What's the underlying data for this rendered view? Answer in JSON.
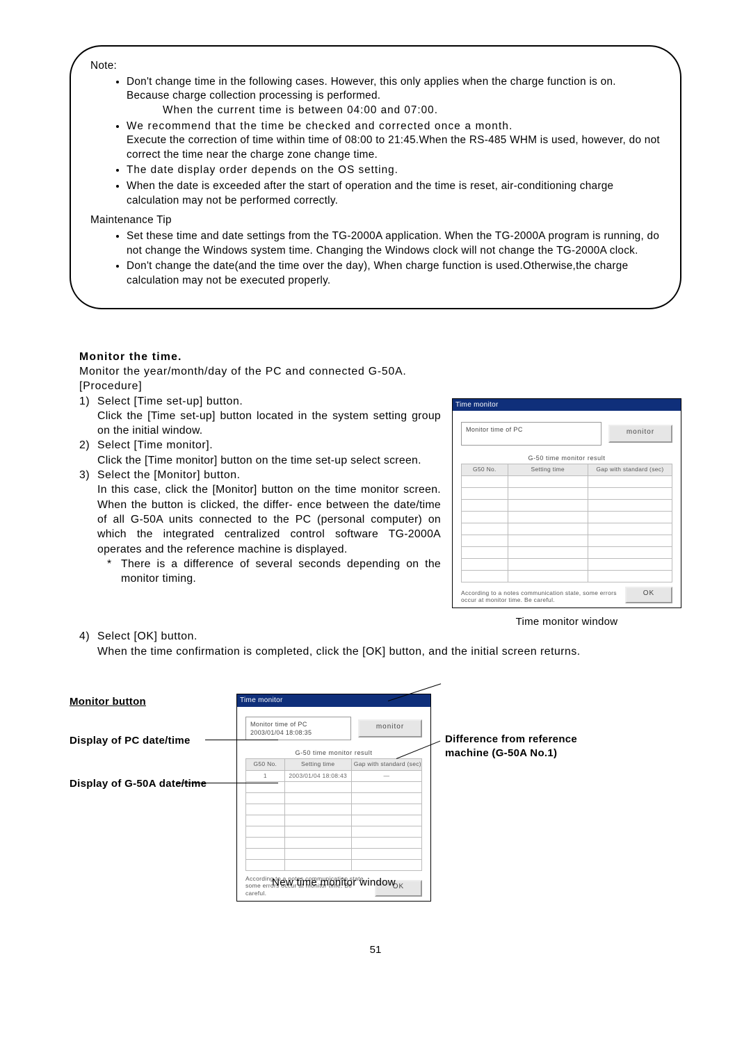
{
  "note": {
    "head": "Note:",
    "b1a": "Don't change time in the following cases. However, this only applies when the charge function is on.",
    "b1b": "Because charge collection processing is performed.",
    "b1c": "When the current time is between 04:00 and 07:00.",
    "b2a": "We recommend that the time be checked and corrected once a month.",
    "b2b": "Execute the correction of time within time of 08:00 to 21:45.When the RS-485 WHM is used, however, do not correct the time near the charge zone change time.",
    "b3": "The date display order depends on the OS setting.",
    "b4": "When the date is exceeded after the start of operation and the time is reset, air-conditioning charge calculation may not be performed correctly.",
    "maint_head": "Maintenance Tip",
    "m1": "Set these time and date settings from the TG-2000A application. When the TG-2000A program is running, do not change the Windows system time. Changing the Windows clock will not change the TG-2000A clock.",
    "m2": "Don't change the date(and the time over the day), When charge function is used.Otherwise,the charge calculation may not be executed properly."
  },
  "section": {
    "title": "Monitor the time.",
    "lead": "Monitor the year/month/day of the PC and connected G-50A.",
    "proc": "[Procedure]",
    "s1_head": "Select [Time set-up] button.",
    "s1_body": "Click the [Time set-up] button located in the system setting group on the initial window.",
    "s2_head": "Select [Time monitor].",
    "s2_body": "Click the [Time monitor] button on the time set-up select screen.",
    "s3_head": "Select the [Monitor] button.",
    "s3_body": "In this case, click the [Monitor] button on the time monitor screen. When the button is clicked, the differ- ence between the date/time of all G-50A units connected to the PC (personal computer) on which the integrated centralized control software TG-2000A operates and the reference machine is displayed.",
    "s3_foot": "There is a difference of several seconds depending on the monitor timing.",
    "s4_head": "Select [OK] button.",
    "s4_body": "When the time confirmation is completed, click the [OK] button, and the initial screen returns."
  },
  "tm1": {
    "title": "Time monitor",
    "pc_label": "Monitor time of PC",
    "pc_val": "",
    "monitor_btn": "monitor",
    "subhead": "G-50 time monitor result",
    "col1": "G50 No.",
    "col2": "Setting time",
    "col3": "Gap with standard (sec)",
    "foot": "According to a notes communication state, some errors occur at monitor time. Be careful.",
    "ok": "OK",
    "caption": "Time monitor window"
  },
  "tm2": {
    "title": "Time monitor",
    "pc_label": "Monitor time of PC",
    "pc_val": "2003/01/04 18:08:35",
    "monitor_btn": "monitor",
    "subhead": "G-50 time monitor result",
    "col1": "G50 No.",
    "col2": "Setting time",
    "col3": "Gap with standard (sec)",
    "row1_c1": "1",
    "row1_c2": "2003/01/04 18:08:43",
    "row1_c3": "—",
    "foot": "According to a notes communication state, some errors occur at monitor time. Be careful.",
    "ok": "OK",
    "caption": "New time monitor window"
  },
  "labels": {
    "pc_dt": "Display of PC date/time",
    "g50_dt": "Display of G-50A date/time",
    "monitor_btn": "Monitor button",
    "diff": "Difference from reference machine (G-50A No.1)"
  },
  "page_num": "51"
}
